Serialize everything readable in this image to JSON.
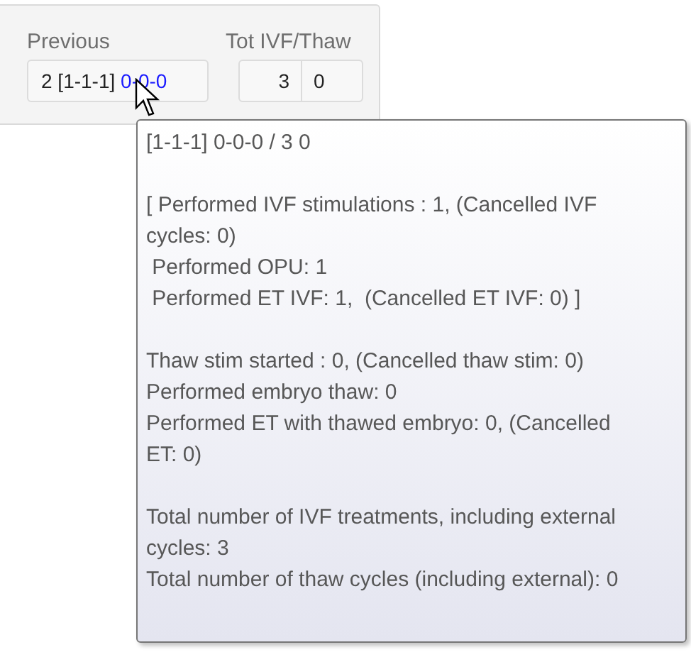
{
  "panel": {
    "previous": {
      "label": "Previous",
      "segments": [
        {
          "text": "2 [1-1-1] ",
          "kind": "plain"
        },
        {
          "text": "0-0-0",
          "kind": "link"
        }
      ]
    },
    "totals": {
      "label": "Tot IVF/Thaw",
      "cells": [
        "3",
        "0"
      ]
    }
  },
  "tooltip": {
    "paragraphs": [
      [
        "[1-1-1] 0-0-0 / 3 0"
      ],
      [
        "[ Performed IVF stimulations : 1, (Cancelled IVF cycles: 0)",
        " Performed OPU: 1",
        " Performed ET IVF: 1,  (Cancelled ET IVF: 0) ]"
      ],
      [
        "Thaw stim started : 0, (Cancelled thaw stim: 0)",
        "Performed embryo thaw: 0",
        "Performed ET with thawed embryo: 0, (Cancelled ET: 0)"
      ],
      [
        "Total number of IVF treatments, including external cycles: 3",
        "Total number of thaw cycles (including external): 0"
      ]
    ]
  }
}
